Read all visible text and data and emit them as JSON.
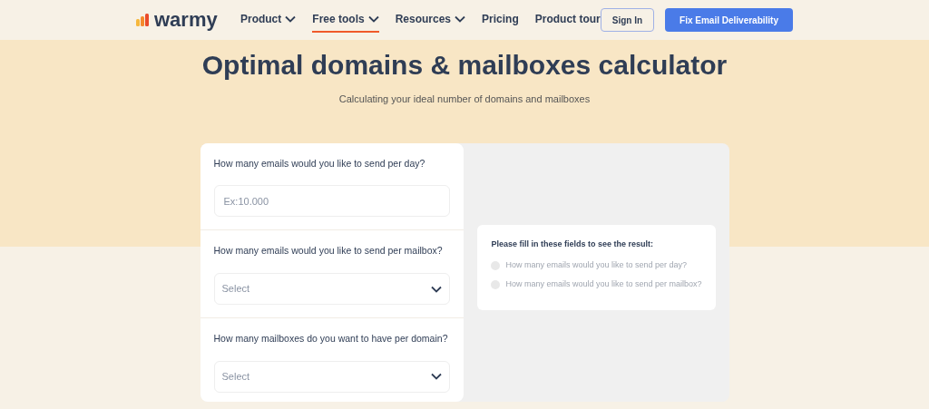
{
  "logo": {
    "text": "warmy"
  },
  "nav": [
    {
      "label": "Product",
      "has_menu": true,
      "selected": false
    },
    {
      "label": "Free tools",
      "has_menu": true,
      "selected": true
    },
    {
      "label": "Resources",
      "has_menu": true,
      "selected": false
    },
    {
      "label": "Pricing",
      "has_menu": false,
      "selected": false
    },
    {
      "label": "Product tour",
      "has_menu": false,
      "selected": false
    }
  ],
  "sign_in": "Sign In",
  "cta": "Fix Email Deliverability",
  "title": "Optimal domains & mailboxes calculator",
  "subtitle": "Calculating your ideal number of domains and mailboxes",
  "fields": [
    {
      "kind": "input",
      "label": "How many emails would you like to send per day?",
      "placeholder": "Ex:10.000"
    },
    {
      "kind": "select",
      "label": "How many emails would you like to send per mailbox?",
      "placeholder": "Select"
    },
    {
      "kind": "select",
      "label": "How many mailboxes do you want to have per domain?",
      "placeholder": "Select"
    }
  ],
  "result": {
    "heading": "Please fill in these fields to see the result:",
    "items": [
      {
        "text": "How many emails would you like to send per day?",
        "done": false
      },
      {
        "text": "How many emails would you like to send per mailbox?",
        "done": false
      }
    ]
  }
}
